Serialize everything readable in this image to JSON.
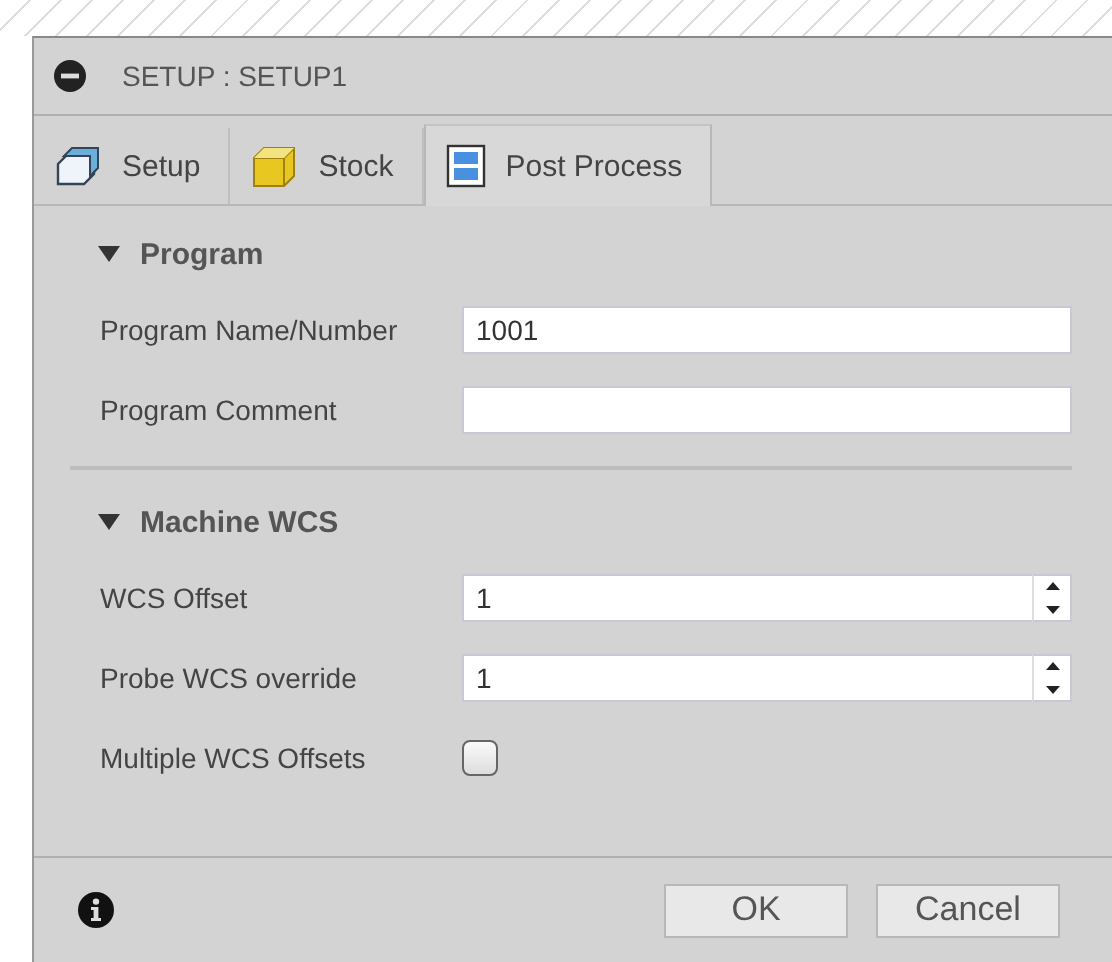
{
  "window": {
    "title": "SETUP : SETUP1"
  },
  "tabs": [
    {
      "label": "Setup",
      "kind": "setup",
      "selected": false
    },
    {
      "label": "Stock",
      "kind": "stock",
      "selected": false
    },
    {
      "label": "Post Process",
      "kind": "post",
      "selected": true
    }
  ],
  "sections": [
    {
      "title": "Program",
      "expanded": true,
      "fields": [
        {
          "kind": "text",
          "label": "Program Name/Number",
          "value": "1001"
        },
        {
          "kind": "text",
          "label": "Program Comment"
        }
      ]
    },
    {
      "title": "Machine WCS",
      "expanded": true,
      "fields": [
        {
          "kind": "spinner",
          "label": "WCS Offset",
          "value": "1"
        },
        {
          "kind": "spinner",
          "label": "Probe WCS override",
          "value": "1"
        },
        {
          "kind": "checkbox",
          "label": "Multiple WCS Offsets",
          "checked": false
        }
      ]
    }
  ],
  "buttons": [
    "OK",
    "Cancel"
  ]
}
